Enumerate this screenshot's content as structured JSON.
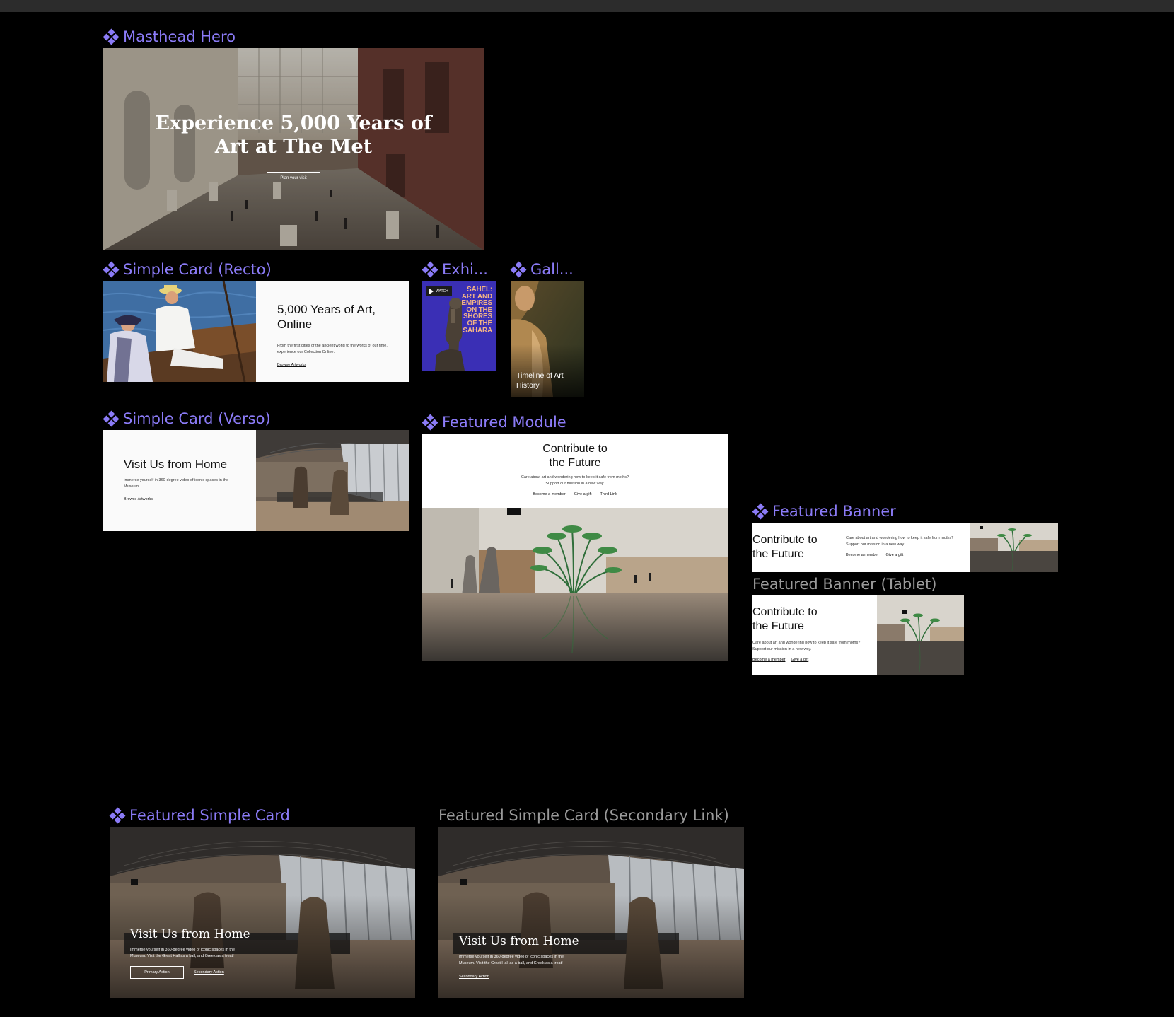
{
  "labels": {
    "masthead": "Masthead Hero",
    "recto": "Simple Card (Recto)",
    "exhi": "Exhi...",
    "gall": "Gall...",
    "verso": "Simple Card (Verso)",
    "featured_module": "Featured Module",
    "featured_banner": "Featured Banner",
    "featured_banner_tablet": "Featured Banner (Tablet)",
    "featured_simple_card": "Featured Simple Card",
    "featured_simple_card_secondary": "Featured Simple Card (Secondary Link)"
  },
  "masthead": {
    "title_line1": "Experience 5,000 Years of",
    "title_line2": "Art at The Met",
    "button": "Plan your visit"
  },
  "recto": {
    "title_line1": "5,000 Years of Art,",
    "title_line2": "Online",
    "body": "From the first cities of the ancient world to the works of our time, experience our Collection Online.",
    "link": "Browse Artworks"
  },
  "exhibition": {
    "watch": "WATCH",
    "title_lines": [
      "SAHEL:",
      "ART AND",
      "EMPIRES",
      "ON THE",
      "SHORES",
      "OF THE",
      "SAHARA"
    ]
  },
  "gallery": {
    "title_line1": "Timeline of Art",
    "title_line2": "History"
  },
  "verso": {
    "title": "Visit Us from Home",
    "body": "Immerse yourself in 360-degree video of iconic spaces in the Museum.",
    "link": "Browse Artworks"
  },
  "featured_module": {
    "title_line1": "Contribute to",
    "title_line2": "the Future",
    "body_line1": "Care about art and wondering how to keep it safe from moths?",
    "body_line2": "Support our mission in a new way.",
    "links": [
      "Become a member",
      "Give a gift",
      "Third Link"
    ]
  },
  "featured_banner": {
    "title_line1": "Contribute to",
    "title_line2": "the Future",
    "body_line1": "Care about art and wondering how to keep it safe from moths?",
    "body_line2": "Support our mission in a new way.",
    "links": [
      "Become a member",
      "Give a gift"
    ]
  },
  "featured_banner_tablet": {
    "title_line1": "Contribute to",
    "title_line2": "the Future",
    "body_line1": "Care about art and wondering how to keep it safe from moths?",
    "body_line2": "Support our mission in a new way.",
    "links": [
      "Become a member",
      "Give a gift"
    ]
  },
  "featured_simple_card": {
    "title": "Visit Us from Home",
    "body_line1": "Immerse yourself in 360-degree video of iconic spaces in the",
    "body_line2": "Museum. Visit the Great Hall as a ball, and Greek as a treat!",
    "primary": "Primary Action",
    "secondary": "Secondary Action"
  },
  "featured_simple_card_secondary": {
    "title": "Visit Us from Home",
    "body_line1": "Immerse yourself in 360-degree video of iconic spaces in the",
    "body_line2": "Museum. Visit the Great Hall as a ball, and Greek as a treat!",
    "secondary": "Secondary Action"
  },
  "colors": {
    "canvas": "#000000",
    "component_label": "#8b7bf7",
    "plain_label": "#9a9a9a",
    "exhibition_bg": "#3a2fb5",
    "exhibition_text": "#f2b486"
  }
}
